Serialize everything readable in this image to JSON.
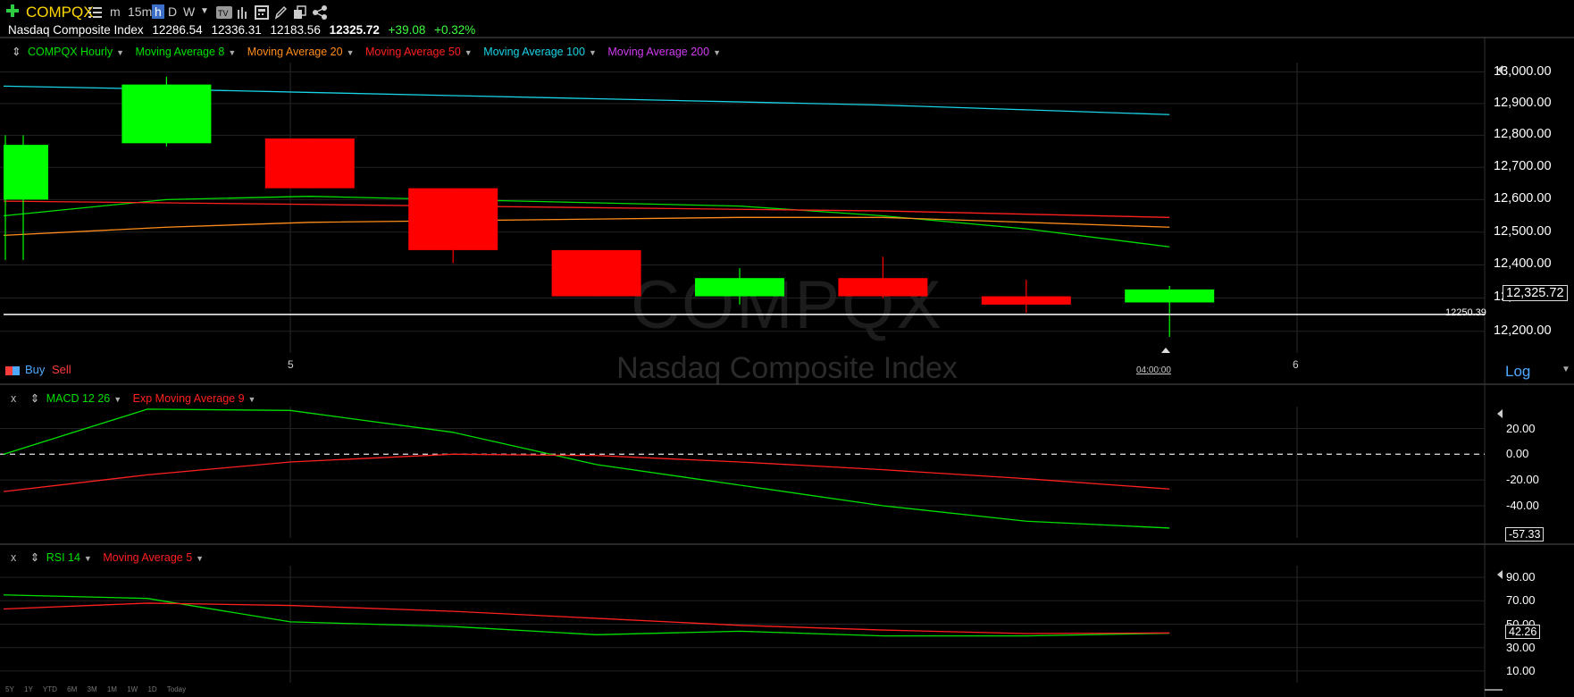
{
  "toolbar": {
    "symbol": "COMPQX",
    "intervals": [
      "m",
      "15m",
      "h",
      "D",
      "W"
    ],
    "active_interval": "h"
  },
  "quote": {
    "name": "Nasdaq Composite Index",
    "open": "12286.54",
    "high": "12336.31",
    "low": "12183.56",
    "last": "12325.72",
    "change": "+39.08",
    "change_pct": "+0.32%"
  },
  "watermark": {
    "symbol": "COMPQX",
    "name": "Nasdaq Composite Index"
  },
  "price_pane": {
    "legend": [
      {
        "label": "COMPQX Hourly",
        "color": "#00e000"
      },
      {
        "label": "Moving Average 8",
        "color": "#00e000"
      },
      {
        "label": "Moving Average 20",
        "color": "#ff8c1a"
      },
      {
        "label": "Moving Average 50",
        "color": "#ff2020"
      },
      {
        "label": "Moving Average 100",
        "color": "#19d3e6"
      },
      {
        "label": "Moving Average 200",
        "color": "#d23cf0"
      }
    ],
    "y_ticks": [
      "13,000.00",
      "12,900.00",
      "12,800.00",
      "12,700.00",
      "12,600.00",
      "12,500.00",
      "12,400.00",
      "12,300.00",
      "12,200.00"
    ],
    "last_price_label": "12,325.72",
    "horizontal_line_label": "12250.39",
    "scale_label": "Log",
    "buy_label": "Buy",
    "sell_label": "Sell",
    "x_labels": [
      "5",
      "04:00:00",
      "6"
    ]
  },
  "macd_pane": {
    "close": "x",
    "legend": [
      {
        "label": "MACD 12 26",
        "color": "#00e000"
      },
      {
        "label": "Exp Moving Average 9",
        "color": "#ff2020"
      }
    ],
    "y_ticks": [
      "20.00",
      "0.00",
      "-20.00",
      "-40.00"
    ],
    "value_label": "-57.33"
  },
  "rsi_pane": {
    "close": "x",
    "legend": [
      {
        "label": "RSI 14",
        "color": "#00e000"
      },
      {
        "label": "Moving Average 5",
        "color": "#ff2020"
      }
    ],
    "y_ticks": [
      "90.00",
      "70.00",
      "50.00",
      "30.00",
      "10.00"
    ],
    "value_label": "42.26"
  },
  "range_buttons": [
    "5Y",
    "1Y",
    "YTD",
    "6M",
    "3M",
    "1M",
    "1W",
    "1D",
    "Today"
  ],
  "colors": {
    "up": "#00ff00",
    "down": "#ff0000",
    "background": "#000000"
  },
  "chart_data": [
    {
      "type": "candlestick",
      "y_scale": "log",
      "ylim": [
        12170,
        13030
      ],
      "grid": true,
      "x_labels": [
        "5",
        "04:00:00",
        "6"
      ],
      "candles": [
        {
          "open": 12600,
          "high": 12800,
          "low": 12415,
          "close": 12770
        },
        {
          "open": 12775,
          "high": 12985,
          "low": 12765,
          "close": 12960
        },
        {
          "open": 12790,
          "high": 12790,
          "low": 12635,
          "close": 12635
        },
        {
          "open": 12635,
          "high": 12635,
          "low": 12405,
          "close": 12445
        },
        {
          "open": 12445,
          "high": 12445,
          "low": 12305,
          "close": 12305
        },
        {
          "open": 12305,
          "high": 12390,
          "low": 12280,
          "close": 12360
        },
        {
          "open": 12360,
          "high": 12425,
          "low": 12300,
          "close": 12305
        },
        {
          "open": 12305,
          "high": 12355,
          "low": 12255,
          "close": 12280
        },
        {
          "open": 12286.54,
          "high": 12336.31,
          "low": 12183.56,
          "close": 12325.72
        }
      ],
      "series": [
        {
          "name": "Moving Average 8",
          "color": "#00e000",
          "values": [
            12550,
            12600,
            12610,
            12600,
            12590,
            12580,
            12550,
            12510,
            12455
          ]
        },
        {
          "name": "Moving Average 20",
          "color": "#ff8c1a",
          "values": [
            12490,
            12515,
            12530,
            12535,
            12540,
            12545,
            12545,
            12530,
            12515
          ]
        },
        {
          "name": "Moving Average 50",
          "color": "#ff2020",
          "values": [
            12595,
            12590,
            12585,
            12580,
            12575,
            12570,
            12565,
            12555,
            12545
          ]
        },
        {
          "name": "Moving Average 100",
          "color": "#19d3e6",
          "values": [
            12955,
            12945,
            12935,
            12925,
            12915,
            12905,
            12895,
            12880,
            12865
          ]
        }
      ],
      "last": 12325.72,
      "horizontal_line": 12250.39
    },
    {
      "type": "line",
      "title": "MACD 12 26",
      "ylim": [
        -65,
        37
      ],
      "series": [
        {
          "name": "MACD 12 26",
          "color": "#00e000",
          "values": [
            0,
            35,
            34,
            17,
            -8,
            -24,
            -40,
            -52,
            -57.33
          ]
        },
        {
          "name": "Exp Moving Average 9",
          "color": "#ff2020",
          "values": [
            -29,
            -16,
            -6,
            0,
            -1,
            -6,
            -12,
            -19,
            -27
          ]
        }
      ]
    },
    {
      "type": "line",
      "title": "RSI 14",
      "ylim": [
        0,
        100
      ],
      "series": [
        {
          "name": "RSI 14",
          "color": "#00e000",
          "values": [
            75,
            72,
            52,
            48,
            41,
            44,
            40,
            40,
            42.26
          ]
        },
        {
          "name": "Moving Average 5",
          "color": "#ff2020",
          "values": [
            63,
            68,
            66,
            61,
            55,
            49,
            45,
            42,
            42.5
          ]
        }
      ]
    }
  ]
}
